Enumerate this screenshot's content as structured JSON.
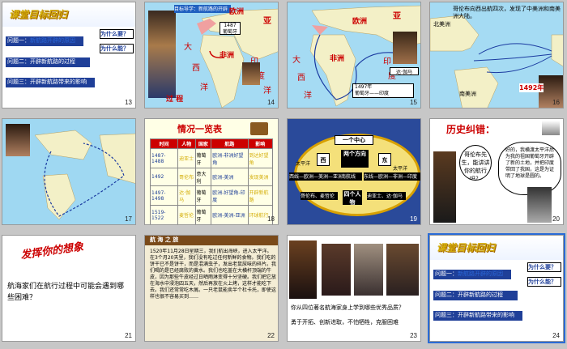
{
  "slides": [
    {
      "num": "13",
      "title": "课堂目标回归",
      "q1": "问题一：",
      "q1_hl": "新航路开辟的原因",
      "q2": "问题二：开辟新航路的过程",
      "q3": "问题三：开辟新航路带来的影响",
      "why": "为什么要？",
      "whyc": "为什么能？"
    },
    {
      "num": "14",
      "tag": "目标导学：新航路的开辟",
      "label1487": "1487",
      "label_port": "葡萄牙",
      "label_guo": "过 程",
      "label_ou": "欧洲",
      "label_ya": "亚",
      "label_fei": "非洲",
      "label_da": "大",
      "label_xi": "西",
      "label_yang": "洋",
      "label_yin": "印",
      "label_du": "度",
      "label_yang2": "洋"
    },
    {
      "num": "15",
      "label_ou": "欧洲",
      "label_ya": "亚",
      "label_fei": "非洲",
      "label_da": "大",
      "label_xi": "西",
      "label_yang": "洋",
      "label_yin": "印",
      "label_du": "度",
      "label_yang2": "洋",
      "cap1": "1497年",
      "cap2": "葡萄牙——印度",
      "name": "达·伽马"
    },
    {
      "num": "16",
      "text": "哥伦布向西出航四次，发现了中美洲和南美洲大陆。",
      "label_na": "北美洲",
      "label_sa": "南美洲",
      "year": "1492年"
    },
    {
      "num": "17"
    },
    {
      "num": "18",
      "title": "情况一览表",
      "headers": [
        "时间",
        "人物",
        "国家",
        "航路",
        "影响"
      ],
      "rows": [
        [
          "1487-1488",
          "迪亚士",
          "葡萄牙",
          "欧洲-非洲好望角",
          "到达好望角"
        ],
        [
          "1492",
          "哥伦布",
          "意大利",
          "欧洲-美洲",
          "发现美洲"
        ],
        [
          "1497-1498",
          "达·伽马",
          "葡萄牙",
          "欧洲-好望角-印度",
          "开辟新航路"
        ],
        [
          "1519-1522",
          "麦哲伦",
          "葡萄牙",
          "欧洲-美洲-亚洲",
          "环球航行"
        ]
      ]
    },
    {
      "num": "19",
      "center": "一个中心",
      "c1": "西",
      "c2": "两个方向",
      "c3": "东",
      "l": "西线—欧洲—美洲—亚洲",
      "r": "东线—欧洲—非洲—印度",
      "p1": "哥伦布、麦哲伦",
      "p2": "四个人物",
      "p3": "迪亚士、达·伽马",
      "rim": "南航线",
      "ocean": "太平洋",
      "ocean2": "太平洋"
    },
    {
      "num": "20",
      "title": "历史纠错：",
      "bubble_l": "哥伦布先生，能讲讲你的航行吗？",
      "bubble_r": "好的，我横渡太平洋后为我的祖国葡萄牙开辟了新的土地，并把印度带回了我国，这是为证明了地球是圆的。"
    },
    {
      "num": "21",
      "title": "发挥你的想象",
      "q": "航海家们在航行过程中可能会遇到哪些困难？"
    },
    {
      "num": "22",
      "head": "航 海 之 旅",
      "body": "1520年11月28日星期三，我们航出海峡，进入太平洋。在3个月20天里，我们没有吃过任何新鲜的食物。我们吃的饼干已不是饼干，而是混满虫子，发出老鼠尿味的碎片。我们喝的是已经腐败的黄水。我们也吃盖在大横杆顶端的牛皮，因为那些牛皮经过日晒雨淋变得十分坚硬。我们把它放在海水中浸泡四五天，然后再放在火上烤，这样才能吃下去。我们还常常吃木屑。一只老鼠能卖半个杜卡托，即使这样也很不容易买到……"
    },
    {
      "num": "23",
      "q": "你从四位著名航海家身上学到哪些优秀品质？",
      "a": "勇于开拓、创新进取，不怕牺牲，克服困难"
    },
    {
      "num": "24",
      "title": "课堂目标回归",
      "q1": "问题一：",
      "q1_hl": "新航路开辟的原因",
      "q2": "问题二：开辟新航路的过程",
      "q3": "问题三：开辟新航路带来的影响",
      "why": "为什么要？",
      "whyc": "为什么能？"
    }
  ]
}
